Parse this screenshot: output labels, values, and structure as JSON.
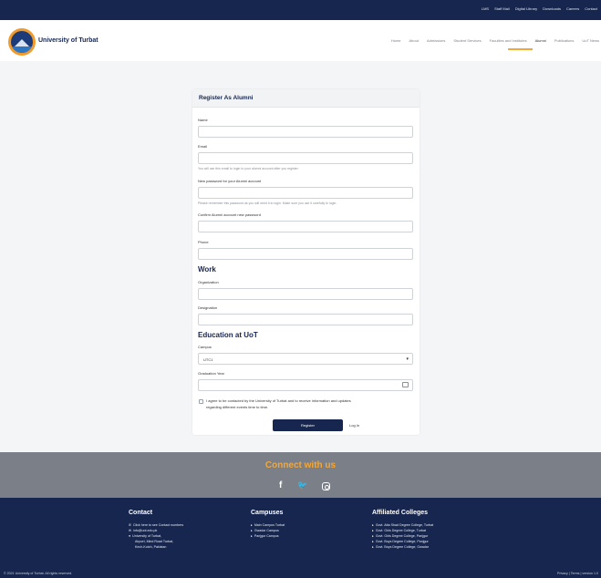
{
  "topbar": {
    "links": [
      "LMS",
      "Staff Mail",
      "Digital Library",
      "Downloads",
      "Careers",
      "Contact"
    ]
  },
  "navbar": {
    "brand": "University of Turbat",
    "items": [
      "Home",
      "About",
      "Admissions",
      "Student Services",
      "Faculties and Institutes",
      "Alumni",
      "Publications",
      "UoT News"
    ],
    "active_item": "Alumni"
  },
  "form": {
    "title": "Register As Alumni",
    "fields": {
      "name_label": "Name",
      "email_label": "Email",
      "email_help": "You will use this email to login to your alumni account after you register.",
      "password_label": "New password for your Alumni account",
      "password_help": "Please remember this password as you will need it to login. Make sure you use it carefully to login.",
      "confirm_label": "Confirm Alumni account new password",
      "phone_label": "Phone"
    },
    "work": {
      "heading": "Work",
      "organization_label": "Organization",
      "designation_label": "Designation"
    },
    "education": {
      "heading": "Education at UoT",
      "campus_label": "Campus",
      "campus_value": "UTC1",
      "graduation_label": "Graduation Year"
    },
    "consent_line1": "I agree to be contacted by the University of Turbat and to receive information and updates",
    "consent_line2": "regarding different events time to time.",
    "register_label": "Register",
    "login_label": "Log In"
  },
  "connect": {
    "title": "Connect with us",
    "facebook_glyph": "f",
    "twitter_glyph": "🐦"
  },
  "footer": {
    "contact": {
      "heading": "Contact",
      "lines": [
        "Click here to see Contact numbers",
        "info@uot.edu.pk",
        "University of Turbat,",
        "Airport, Mind Road Turbat,",
        "Kech-Kutch, Pakistan"
      ]
    },
    "campuses": {
      "heading": "Campuses",
      "items": [
        "Main Campus Turbat",
        "Gwadar Campus",
        "Panjgur Campus"
      ]
    },
    "colleges": {
      "heading": "Affiliated Colleges",
      "items": [
        "Govt. Atta Shad Degree College, Turbat",
        "Govt. Girls Degree College, Turbat",
        "Govt. Girls Degree College, Panjgur",
        "Govt. Boys Degree College, Panjgur",
        "Govt. Boys Degree College, Gwadar"
      ]
    },
    "copyright": "© 2021 University of Turbat. All rights reserved.",
    "bottom_links": "Privacy  |  Terms  |  version 1.0"
  },
  "colors": {
    "navy": "#16264f",
    "accent": "#f2a73b",
    "band_gray": "#7b8088"
  }
}
